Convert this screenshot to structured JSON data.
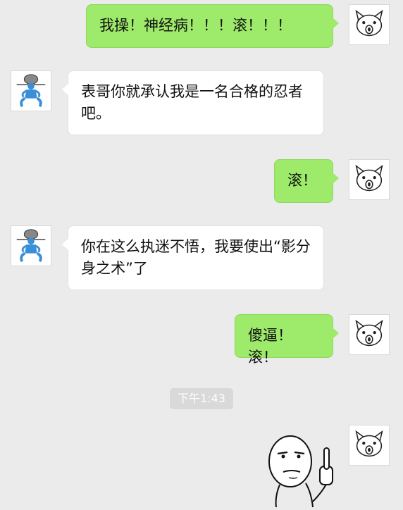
{
  "messages": [
    {
      "sender": "me",
      "text": "我操！神经病！！！滚！！！"
    },
    {
      "sender": "other",
      "text": "表哥你就承认我是一名合格的忍者吧。"
    },
    {
      "sender": "me",
      "text": "滚！"
    },
    {
      "sender": "other",
      "text": "你在这么执迷不悟，我要使出“影分身之术”了"
    },
    {
      "sender": "me",
      "text": "傻逼！滚！"
    },
    {
      "sender": "me",
      "text": "",
      "sticker": "rage-comic-middle-finger"
    }
  ],
  "timestamp": "下午1:43",
  "avatars": {
    "me": "cartoon-pig-face-icon",
    "other": "blue-ninja-squatting-icon"
  },
  "colors": {
    "background": "#ebebeb",
    "my_bubble": "#9eea6a",
    "other_bubble": "#ffffff",
    "time_badge": "#d9d9d9"
  }
}
